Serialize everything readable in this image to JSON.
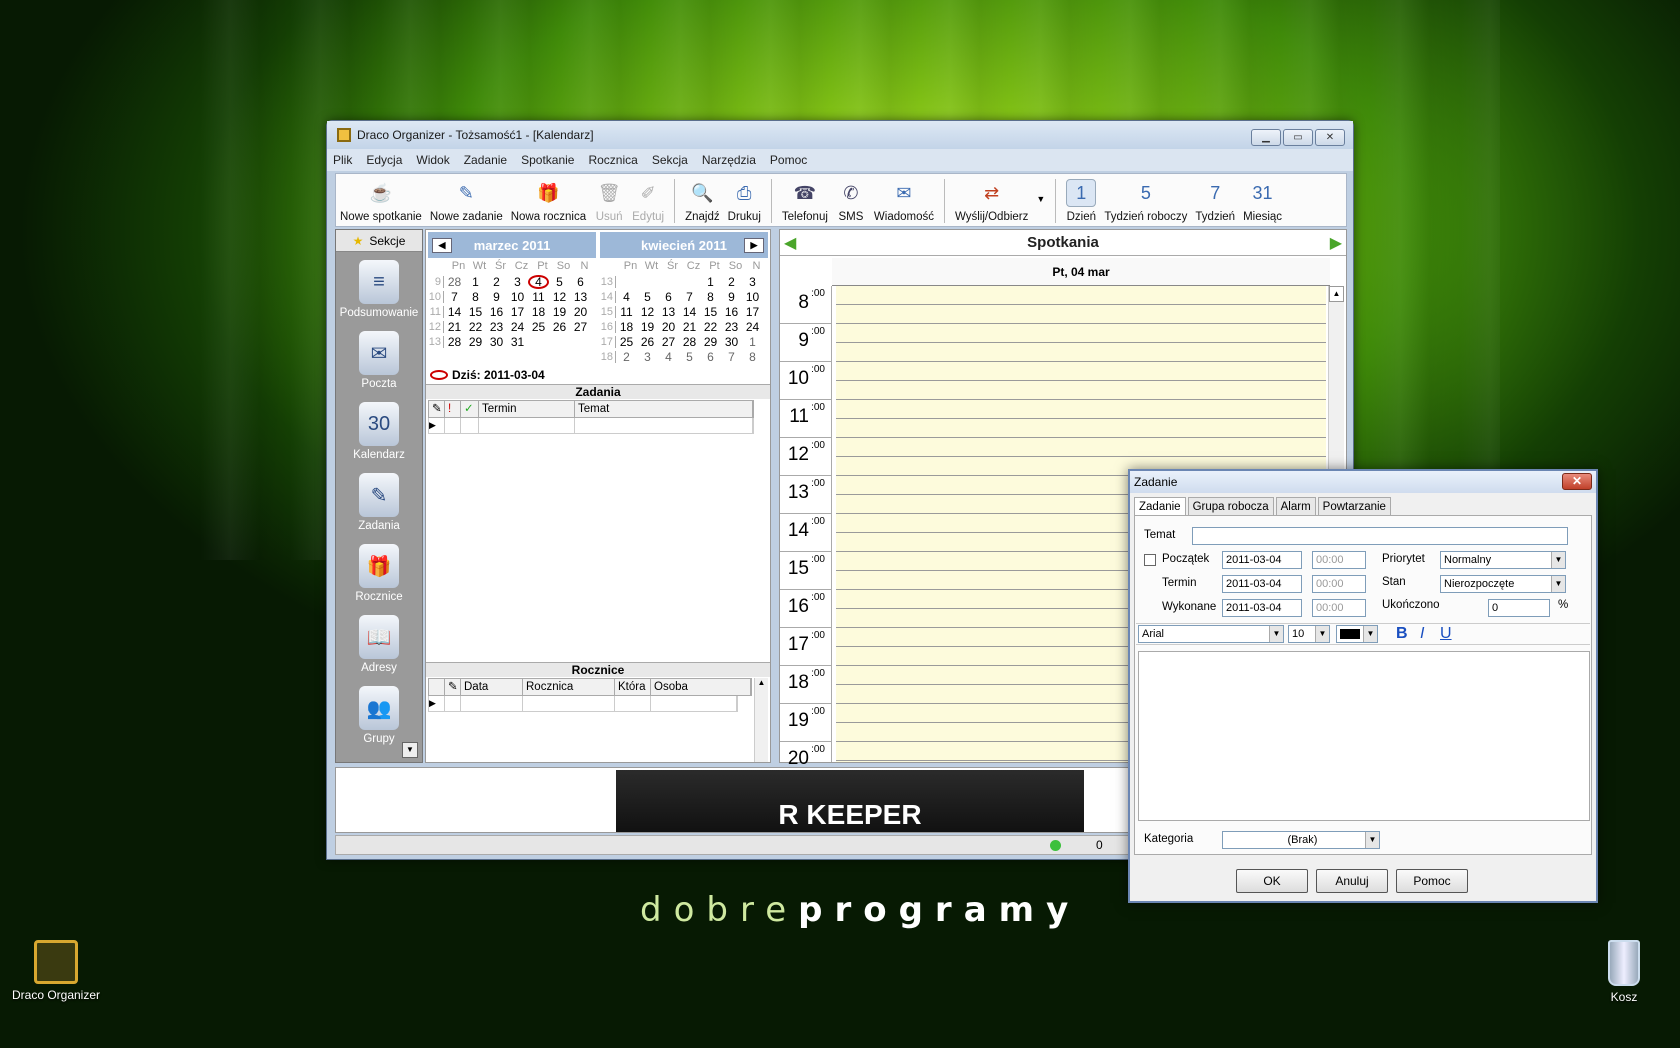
{
  "desktop": {
    "icons": [
      {
        "label": "Draco Organizer"
      },
      {
        "label": "Kosz"
      }
    ],
    "brand_light": "dobre",
    "brand_bold": "programy"
  },
  "window": {
    "title": "Draco Organizer - Tożsamość1 - [Kalendarz]",
    "menu": [
      "Plik",
      "Edycja",
      "Widok",
      "Zadanie",
      "Spotkanie",
      "Rocznica",
      "Sekcja",
      "Narzędzia",
      "Pomoc"
    ],
    "toolbar": [
      {
        "label": "Nowe spotkanie",
        "icon": "cup-icon",
        "enabled": true
      },
      {
        "label": "Nowe zadanie",
        "icon": "task-icon",
        "enabled": true
      },
      {
        "label": "Nowa rocznica",
        "icon": "gift-icon",
        "enabled": true
      },
      {
        "label": "Usuń",
        "icon": "trash-icon",
        "enabled": false
      },
      {
        "label": "Edytuj",
        "icon": "edit-icon",
        "enabled": false
      },
      {
        "label": "Znajdź",
        "icon": "find-icon",
        "enabled": true
      },
      {
        "label": "Drukuj",
        "icon": "print-icon",
        "enabled": true
      },
      {
        "label": "Telefonuj",
        "icon": "phone-icon",
        "enabled": true
      },
      {
        "label": "SMS",
        "icon": "sms-icon",
        "enabled": true
      },
      {
        "label": "Wiadomość",
        "icon": "mail-icon",
        "enabled": true
      },
      {
        "label": "Wyślij/Odbierz",
        "icon": "send-receive-icon",
        "enabled": true
      },
      {
        "label": "Dzień",
        "icon": "day-icon",
        "enabled": true
      },
      {
        "label": "Tydzień roboczy",
        "icon": "work-week-icon",
        "enabled": true
      },
      {
        "label": "Tydzień",
        "icon": "week-icon",
        "enabled": true
      },
      {
        "label": "Miesiąc",
        "icon": "month-icon",
        "enabled": true
      }
    ],
    "sidebar": {
      "header": "Sekcje",
      "items": [
        {
          "label": "Podsumowanie",
          "icon": "summary-icon"
        },
        {
          "label": "Poczta",
          "icon": "envelope-icon"
        },
        {
          "label": "Kalendarz",
          "icon": "calendar-icon"
        },
        {
          "label": "Zadania",
          "icon": "tasks-icon"
        },
        {
          "label": "Rocznice",
          "icon": "anniversary-icon"
        },
        {
          "label": "Adresy",
          "icon": "address-book-icon"
        },
        {
          "label": "Grupy",
          "icon": "groups-icon"
        }
      ]
    },
    "calendars": [
      {
        "title": "marzec 2011",
        "dow": [
          "Pn",
          "Wt",
          "Śr",
          "Cz",
          "Pt",
          "So",
          "N"
        ],
        "weeks": [
          {
            "n": "9",
            "d": [
              "28",
              "1",
              "2",
              "3",
              "4",
              "5",
              "6"
            ]
          },
          {
            "n": "10",
            "d": [
              "7",
              "8",
              "9",
              "10",
              "11",
              "12",
              "13"
            ]
          },
          {
            "n": "11",
            "d": [
              "14",
              "15",
              "16",
              "17",
              "18",
              "19",
              "20"
            ]
          },
          {
            "n": "12",
            "d": [
              "21",
              "22",
              "23",
              "24",
              "25",
              "26",
              "27"
            ]
          },
          {
            "n": "13",
            "d": [
              "28",
              "29",
              "30",
              "31",
              "",
              "",
              ""
            ]
          }
        ]
      },
      {
        "title": "kwiecień 2011",
        "dow": [
          "Pn",
          "Wt",
          "Śr",
          "Cz",
          "Pt",
          "So",
          "N"
        ],
        "weeks": [
          {
            "n": "13",
            "d": [
              "",
              "",
              "",
              "",
              "1",
              "2",
              "3"
            ]
          },
          {
            "n": "14",
            "d": [
              "4",
              "5",
              "6",
              "7",
              "8",
              "9",
              "10"
            ]
          },
          {
            "n": "15",
            "d": [
              "11",
              "12",
              "13",
              "14",
              "15",
              "16",
              "17"
            ]
          },
          {
            "n": "16",
            "d": [
              "18",
              "19",
              "20",
              "21",
              "22",
              "23",
              "24"
            ]
          },
          {
            "n": "17",
            "d": [
              "25",
              "26",
              "27",
              "28",
              "29",
              "30",
              "1"
            ]
          },
          {
            "n": "18",
            "d": [
              "2",
              "3",
              "4",
              "5",
              "6",
              "7",
              "8"
            ]
          }
        ]
      }
    ],
    "today_label": "Dziś: 2011-03-04",
    "tasks": {
      "header": "Zadania",
      "columns": [
        "Termin",
        "Temat"
      ]
    },
    "anniversaries": {
      "header": "Rocznice",
      "columns": [
        "Data",
        "Rocznica",
        "Która",
        "Osoba"
      ]
    },
    "schedule": {
      "title": "Spotkania",
      "day": "Pt, 04 mar",
      "hours": [
        "8",
        "9",
        "10",
        "11",
        "12",
        "13",
        "14",
        "15",
        "16",
        "17",
        "18",
        "19",
        "20"
      ],
      "minutes": ":00"
    },
    "ad_text": "R KEEPER",
    "status_count": "0"
  },
  "dialog": {
    "title": "Zadanie",
    "tabs": [
      "Zadanie",
      "Grupa robocza",
      "Alarm",
      "Powtarzanie"
    ],
    "labels": {
      "temat": "Temat",
      "poczatek": "Początek",
      "termin": "Termin",
      "wykonane": "Wykonane",
      "priorytet": "Priorytet",
      "stan": "Stan",
      "ukonczono": "Ukończono",
      "kategoria": "Kategoria"
    },
    "dates": {
      "poczatek": "2011-03-04",
      "termin": "2011-03-04",
      "wykonane": "2011-03-04"
    },
    "time": "00:00",
    "priority": "Normalny",
    "status": "Nierozpoczęte",
    "percent": "0",
    "percent_sign": "%",
    "font": "Arial",
    "size": "10",
    "category": "(Brak)",
    "buttons": {
      "ok": "OK",
      "cancel": "Anuluj",
      "help": "Pomoc"
    }
  }
}
